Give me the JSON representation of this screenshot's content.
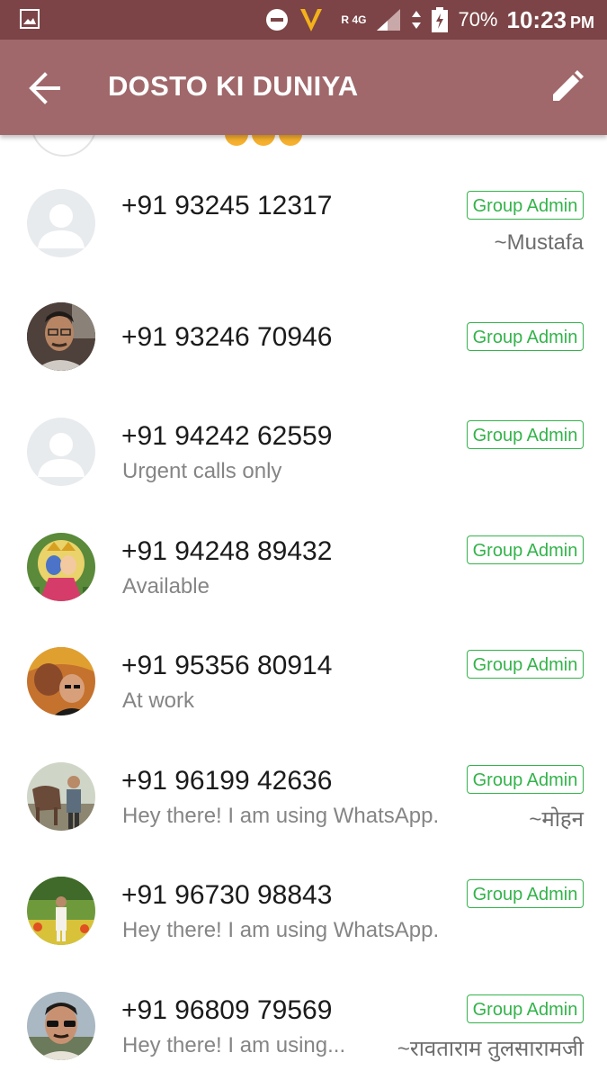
{
  "status_bar": {
    "battery": "70%",
    "time": "10:23",
    "ampm": "PM",
    "network": "4G",
    "roaming": "R"
  },
  "app_bar": {
    "title": "DOSTO KI DUNIYA"
  },
  "members": [
    {
      "number": "+91 93245 12317",
      "status": "",
      "badge": "Group Admin",
      "alias": "~Mustafa",
      "avatar": "default"
    },
    {
      "number": "+91 93246 70946",
      "status": "",
      "badge": "Group Admin",
      "alias": "",
      "avatar": "photo"
    },
    {
      "number": "+91 94242 62559",
      "status": "Urgent calls only",
      "badge": "Group Admin",
      "alias": "",
      "avatar": "default"
    },
    {
      "number": "+91 94248 89432",
      "status": "Available",
      "badge": "Group Admin",
      "alias": "",
      "avatar": "photo"
    },
    {
      "number": "+91 95356 80914",
      "status": "At work",
      "badge": "Group Admin",
      "alias": "",
      "avatar": "photo"
    },
    {
      "number": "+91 96199 42636",
      "status": "Hey there! I am using WhatsApp.",
      "badge": "Group Admin",
      "alias": "~मोहन",
      "avatar": "photo"
    },
    {
      "number": "+91 96730 98843",
      "status": "Hey there! I am using WhatsApp.",
      "badge": "Group Admin",
      "alias": "",
      "avatar": "photo"
    },
    {
      "number": "+91 96809 79569",
      "status": "Hey there! I am using...",
      "badge": "Group Admin",
      "alias": "~रावताराम तुलसारामजी",
      "avatar": "photo"
    }
  ]
}
